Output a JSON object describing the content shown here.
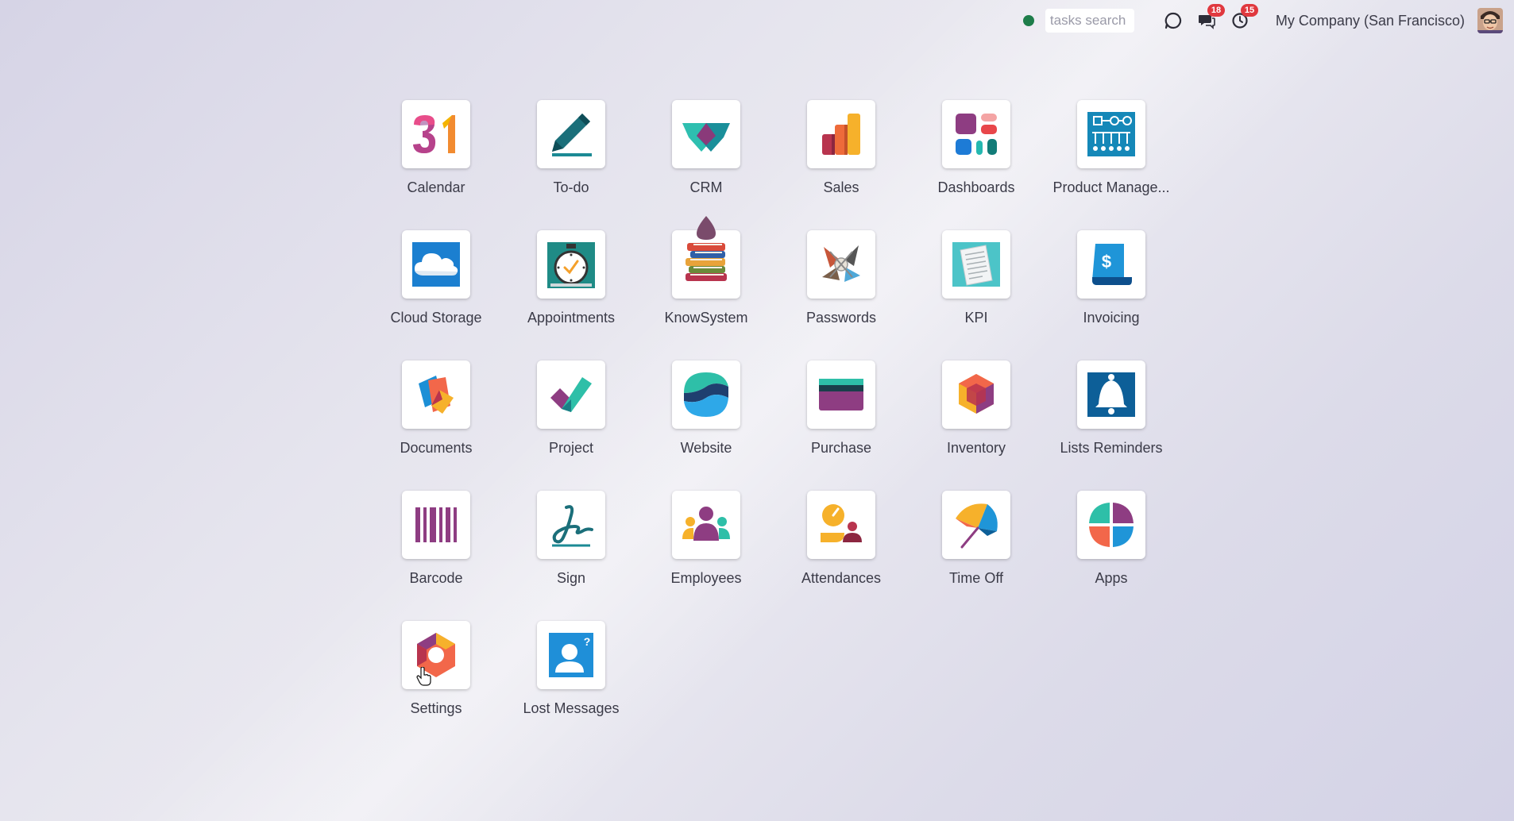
{
  "topbar": {
    "search_placeholder": "tasks search",
    "messages_badge": "18",
    "activities_badge": "15",
    "company": "My Company (San Francisco)"
  },
  "icons": {
    "status": "online-status-dot",
    "discuss": "refresh-chat-icon",
    "messages": "chat-bubbles-icon",
    "activities": "clock-icon",
    "avatar": "user-avatar"
  },
  "apps": [
    {
      "label": "Calendar",
      "icon": "calendar-icon"
    },
    {
      "label": "To-do",
      "icon": "pen-icon"
    },
    {
      "label": "CRM",
      "icon": "handshake-icon"
    },
    {
      "label": "Sales",
      "icon": "bar-chart-icon"
    },
    {
      "label": "Dashboards",
      "icon": "dashboard-tiles-icon"
    },
    {
      "label": "Product Manage...",
      "icon": "product-management-icon"
    },
    {
      "label": "Cloud Storage",
      "icon": "cloud-icon"
    },
    {
      "label": "Appointments",
      "icon": "stopwatch-icon"
    },
    {
      "label": "KnowSystem",
      "icon": "books-icon"
    },
    {
      "label": "Passwords",
      "icon": "passwords-icon"
    },
    {
      "label": "KPI",
      "icon": "kpi-document-icon"
    },
    {
      "label": "Invoicing",
      "icon": "invoice-icon"
    },
    {
      "label": "Documents",
      "icon": "documents-icon"
    },
    {
      "label": "Project",
      "icon": "checkmark-icon"
    },
    {
      "label": "Website",
      "icon": "website-waves-icon"
    },
    {
      "label": "Purchase",
      "icon": "credit-card-icon"
    },
    {
      "label": "Inventory",
      "icon": "cube-icon"
    },
    {
      "label": "Lists Reminders",
      "icon": "bell-icon"
    },
    {
      "label": "Barcode",
      "icon": "barcode-icon"
    },
    {
      "label": "Sign",
      "icon": "signature-icon"
    },
    {
      "label": "Employees",
      "icon": "people-icon"
    },
    {
      "label": "Attendances",
      "icon": "attendance-icon"
    },
    {
      "label": "Time Off",
      "icon": "umbrella-icon"
    },
    {
      "label": "Apps",
      "icon": "apps-icon"
    },
    {
      "label": "Settings",
      "icon": "gear-hexagon-icon"
    },
    {
      "label": "Lost Messages",
      "icon": "lost-messages-icon"
    }
  ]
}
